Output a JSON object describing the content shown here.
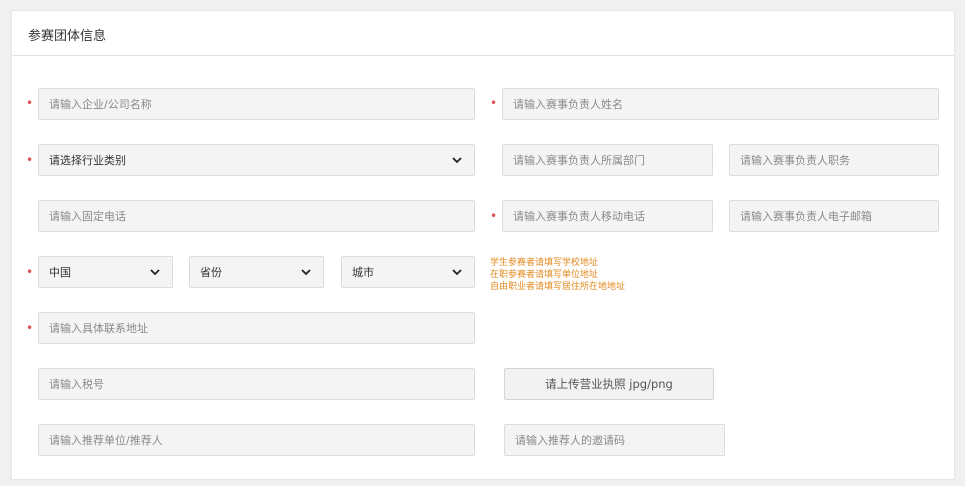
{
  "section": {
    "title": "参赛团体信息"
  },
  "required_mark": "•",
  "fields": {
    "company_name": {
      "placeholder": "请输入企业/公司名称"
    },
    "leader_name": {
      "placeholder": "请输入赛事负责人姓名"
    },
    "industry": {
      "value": "请选择行业类别"
    },
    "leader_department": {
      "placeholder": "请输入赛事负责人所属部门"
    },
    "leader_title": {
      "placeholder": "请输入赛事负责人职务"
    },
    "landline": {
      "placeholder": "请输入固定电话"
    },
    "leader_mobile": {
      "placeholder": "请输入赛事负责人移动电话"
    },
    "leader_email": {
      "placeholder": "请输入赛事负责人电子邮箱"
    },
    "country": {
      "value": "中国"
    },
    "province": {
      "value": "省份"
    },
    "city": {
      "value": "城市"
    },
    "address": {
      "placeholder": "请输入具体联系地址"
    },
    "tax_number": {
      "placeholder": "请输入税号"
    },
    "license_upload": {
      "label": "请上传营业执照 jpg/png"
    },
    "referrer": {
      "placeholder": "请输入推荐单位/推荐人"
    },
    "invite_code": {
      "placeholder": "请输入推荐人的邀请码"
    }
  },
  "address_hints": [
    "学生参赛者请填写学校地址",
    "在职参赛者请填写单位地址",
    "自由职业者请填写居住所在地地址"
  ],
  "colors": {
    "required": "#e05050",
    "hint": "#e08a1e",
    "field_bg": "#f4f4f4",
    "border": "#dcdcdc"
  }
}
